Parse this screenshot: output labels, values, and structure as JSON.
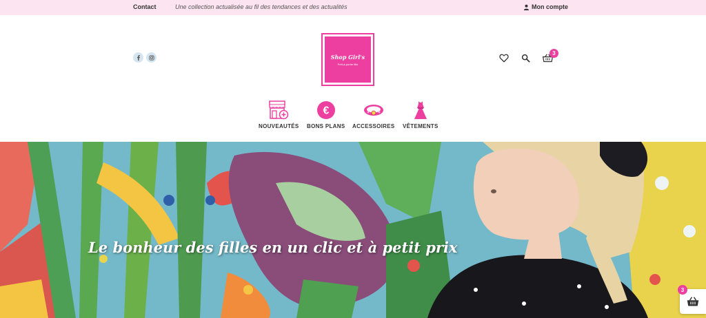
{
  "topbar": {
    "contact": "Contact",
    "tagline": "Une collection actualisée au fil des tendances et des actualités",
    "account": "Mon compte"
  },
  "logo": {
    "title": "Shop Girl's",
    "subtitle": "Prêt-à-porter fille"
  },
  "header": {
    "cart_count": "3"
  },
  "categories": [
    {
      "label": "NOUVEAUTÉS",
      "icon": "shop-icon"
    },
    {
      "label": "BONS PLANS",
      "icon": "euro-icon"
    },
    {
      "label": "ACCESSOIRES",
      "icon": "bracelet-icon"
    },
    {
      "label": "VÊTEMENTS",
      "icon": "dress-icon"
    }
  ],
  "hero": {
    "text": "Le bonheur des filles en un clic et à petit prix"
  },
  "floating_cart": {
    "count": "3"
  },
  "colors": {
    "accent": "#ec3fa0",
    "topbar_bg": "#fce4f0"
  }
}
